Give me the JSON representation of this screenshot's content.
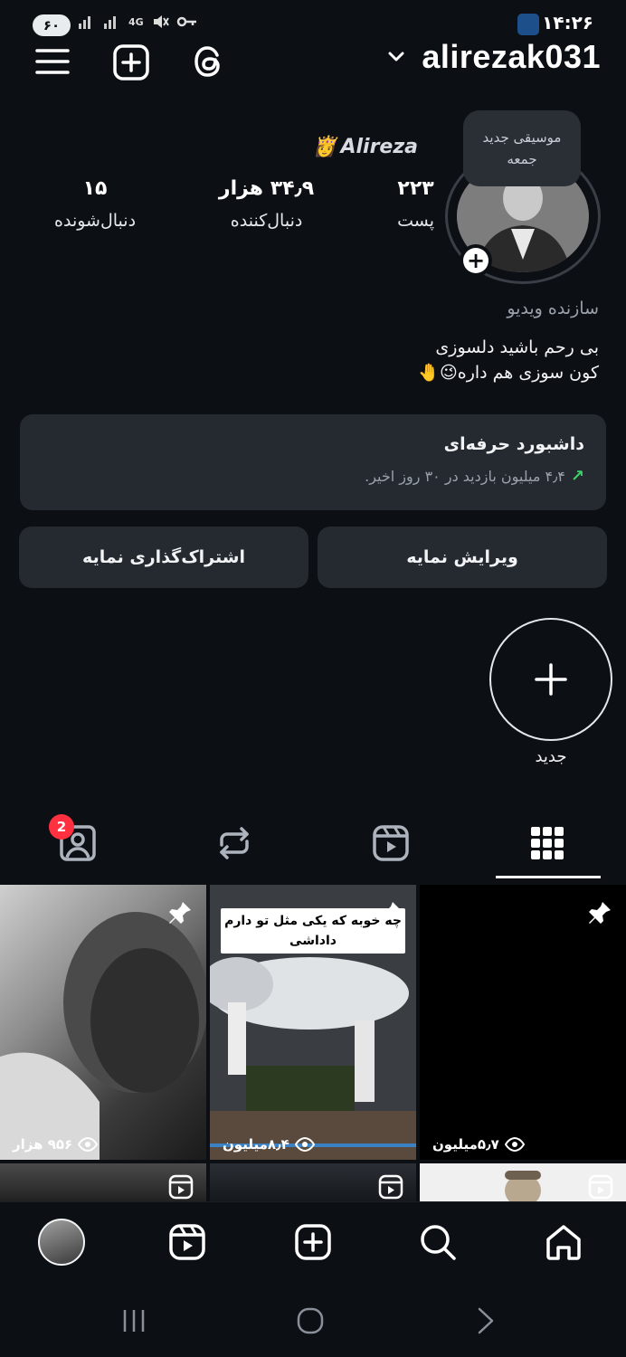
{
  "status_bar": {
    "battery": "۶۰",
    "network": "4G",
    "time": "۱۴:۲۶"
  },
  "header": {
    "username": "alirezak031"
  },
  "profile": {
    "note": {
      "line1": "موسیقی جدید",
      "line2": "جمعه"
    },
    "display_name": "Alireza",
    "display_name_emoji": "👸",
    "stats": {
      "posts": {
        "value": "۲۲۳",
        "label": "پست"
      },
      "followers": {
        "value": "۳۴٫۹ هزار",
        "label": "دنبال‌کننده"
      },
      "following": {
        "value": "۱۵",
        "label": "دنبال‌شونده"
      }
    },
    "category": "سازنده ویدیو",
    "bio_line1": "بی رحم باشید دلسوزی",
    "bio_line2": "کون سوزی هم داره😉🤚"
  },
  "dashboard": {
    "title": "داشبورد حرفه‌ای",
    "subtitle": "۴٫۴ میلیون بازدید در ۳۰ روز اخیر.",
    "arrow": "↗"
  },
  "buttons": {
    "edit": "ویرایش نمایه",
    "share": "اشتراک‌گذاری نمایه"
  },
  "highlight": {
    "new_label": "جدید"
  },
  "tabs": {
    "tagged_badge": "2"
  },
  "posts": [
    {
      "views": "۹۵۶ هزار",
      "pinned": true
    },
    {
      "views": "۸٫۴میلیون",
      "pinned": true,
      "caption_line1": "چه خوبه که یکی مثل تو دارم",
      "caption_line2": "داداشی"
    },
    {
      "views": "۵٫۷میلیون",
      "pinned": true
    }
  ],
  "colors": {
    "background": "#0c0f14",
    "card": "#252930",
    "badge": "#ff3040",
    "trend_green": "#3fd06b"
  }
}
